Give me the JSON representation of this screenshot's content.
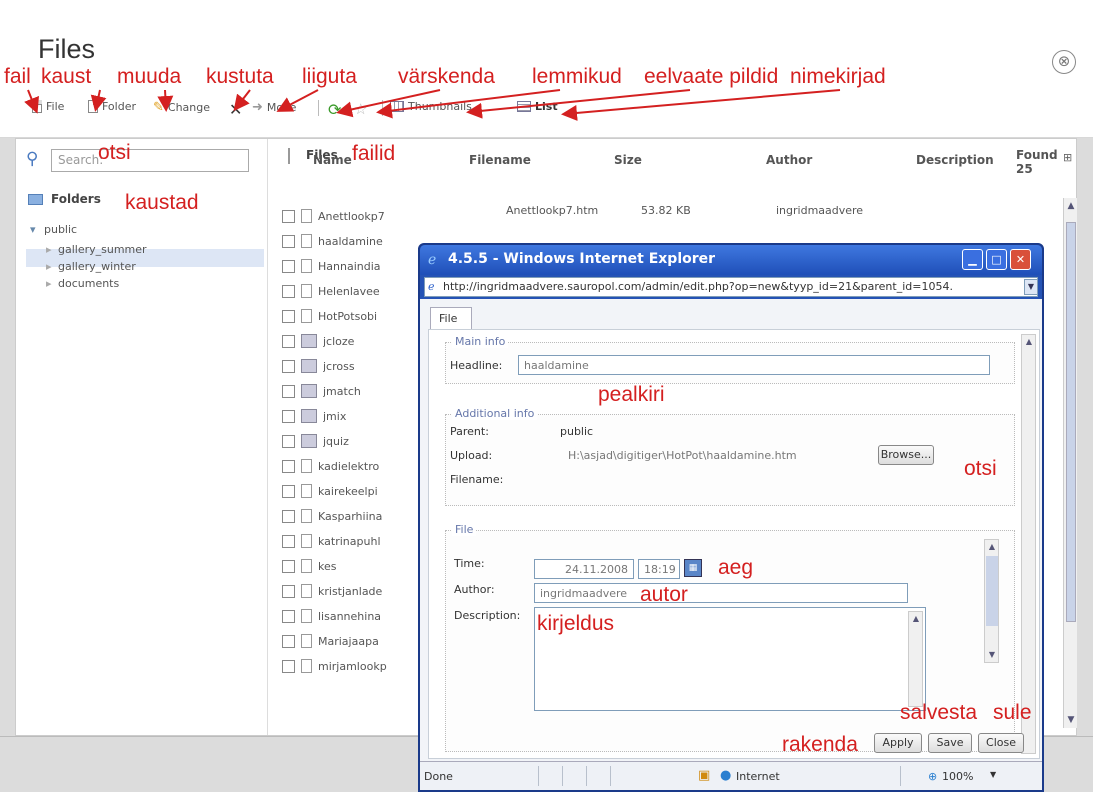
{
  "header": {
    "title": "Files",
    "close_symbol": "⊗"
  },
  "toolbar": {
    "file_label": "File",
    "folder_label": "Folder",
    "change_label": "Change",
    "move_label": "Move",
    "thumbnails_label": "Thumbnails",
    "list_label": "List"
  },
  "annotations": {
    "fail": "fail",
    "kaust": "kaust",
    "muuda": "muuda",
    "kustuta": "kustuta",
    "liiguta": "liiguta",
    "varskenda": "värskenda",
    "lemmikud": "lemmikud",
    "eelvaate_pildid": "eelvaate pildid",
    "nimekirjad": "nimekirjad",
    "otsi_search": "otsi",
    "kaustad": "kaustad",
    "failid": "failid",
    "pealkiri": "pealkiri",
    "otsi_browse": "otsi",
    "aeg": "aeg",
    "autor": "autor",
    "kirjeldus": "kirjeldus",
    "salvesta": "salvesta",
    "sule": "sule",
    "rakenda": "rakenda"
  },
  "sidebar": {
    "search_placeholder": "Search:",
    "folders_label": "Folders",
    "root": "public",
    "children": [
      "gallery_summer",
      "gallery_winter",
      "documents"
    ]
  },
  "files": {
    "title": "Files",
    "found": "Found 25",
    "columns": [
      "Name",
      "Filename",
      "Size",
      "Author",
      "Description"
    ],
    "first_row": {
      "filename": "Anettlookp7.htm",
      "size": "53.82 KB",
      "author": "ingridmaadvere"
    },
    "rows": [
      {
        "name": "Anettlookp7",
        "type": "doc"
      },
      {
        "name": "haaldamine",
        "type": "doc"
      },
      {
        "name": "Hannaindia",
        "type": "doc"
      },
      {
        "name": "Helenlavee",
        "type": "doc"
      },
      {
        "name": "HotPotsobi",
        "type": "doc"
      },
      {
        "name": "jcloze",
        "type": "exe"
      },
      {
        "name": "jcross",
        "type": "exe"
      },
      {
        "name": "jmatch",
        "type": "exe"
      },
      {
        "name": "jmix",
        "type": "exe"
      },
      {
        "name": "jquiz",
        "type": "exe"
      },
      {
        "name": "kadielektro",
        "type": "doc"
      },
      {
        "name": "kairekeelpi",
        "type": "doc"
      },
      {
        "name": "Kasparhiina",
        "type": "doc"
      },
      {
        "name": "katrinapuhl",
        "type": "doc"
      },
      {
        "name": "kes",
        "type": "doc"
      },
      {
        "name": "kristjanlade",
        "type": "doc"
      },
      {
        "name": "lisannehina",
        "type": "doc"
      },
      {
        "name": "Mariajaapa",
        "type": "doc"
      },
      {
        "name": "mirjamlookp",
        "type": "doc"
      }
    ]
  },
  "dialog": {
    "window_title": "4.5.5 - Windows Internet Explorer",
    "url": "http://ingridmaadvere.sauropol.com/admin/edit.php?op=new&tyyp_id=21&parent_id=1054.",
    "tab": "File",
    "main_info_legend": "Main info",
    "headline_label": "Headline:",
    "headline_value": "haaldamine",
    "additional_info_legend": "Additional info",
    "parent_label": "Parent:",
    "parent_value": "public",
    "upload_label": "Upload:",
    "upload_value": "H:\\asjad\\digitiger\\HotPot\\haaldamine.htm",
    "browse_label": "Browse...",
    "filename_label": "Filename:",
    "file_legend": "File",
    "time_label": "Time:",
    "date_value": "24.11.2008",
    "time_value": "18:19",
    "author_label": "Author:",
    "author_value": "ingridmaadvere",
    "description_label": "Description:",
    "apply_label": "Apply",
    "save_label": "Save",
    "close_label": "Close",
    "status_done": "Done",
    "status_zone": "Internet",
    "zoom": "100%"
  }
}
